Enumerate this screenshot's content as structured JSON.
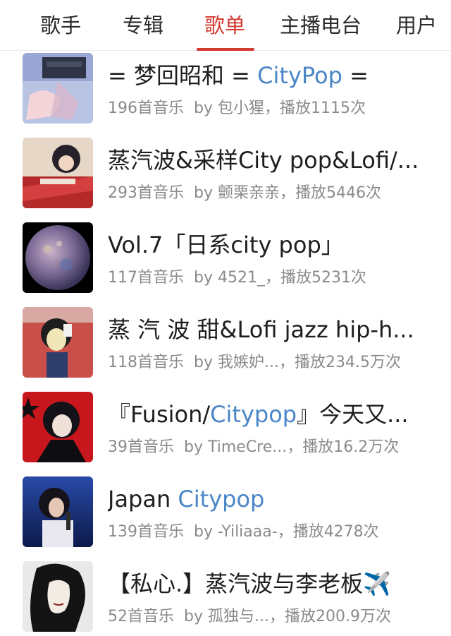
{
  "tabs": [
    {
      "label": "歌手",
      "active": false
    },
    {
      "label": "专辑",
      "active": false
    },
    {
      "label": "歌单",
      "active": true
    },
    {
      "label": "主播电台",
      "active": false
    },
    {
      "label": "用户",
      "active": false
    }
  ],
  "colors": {
    "accent": "#d33a31",
    "highlight": "#4a86c7",
    "meta": "#8a8a8a"
  },
  "playlists": [
    {
      "title_pre": "= 梦回昭和 = ",
      "title_hl": "CityPop",
      "title_post": " =",
      "count": "196首音乐",
      "by": "by 包小猩",
      "plays": "，播放1115次"
    },
    {
      "title_pre": "蒸汽波&采样City pop&Lofi/...",
      "title_hl": "",
      "title_post": "",
      "count": "293首音乐",
      "by": "by 颤栗亲亲",
      "plays": "，播放5446次"
    },
    {
      "title_pre": "Vol.7「日系city pop」",
      "title_hl": "",
      "title_post": "",
      "count": "117首音乐",
      "by": "by 4521_",
      "plays": "，播放5231次"
    },
    {
      "title_pre": "蒸 汽 波 甜&Lofi jazz hip-h...",
      "title_hl": "",
      "title_post": "",
      "count": "118首音乐",
      "by": "by 我嫉妒...",
      "plays": "，播放234.5万次"
    },
    {
      "title_pre": "『Fusion/",
      "title_hl": "Citypop",
      "title_post": "』今天又...",
      "count": "39首音乐",
      "by": "by TimeCre...",
      "plays": "，播放16.2万次"
    },
    {
      "title_pre": "Japan ",
      "title_hl": "Citypop",
      "title_post": "",
      "count": "139首音乐",
      "by": "by -Yiliaaa-",
      "plays": "，播放4278次"
    },
    {
      "title_pre": "【私心.】蒸汽波与李老板✈️",
      "title_hl": "",
      "title_post": "",
      "count": "52首音乐",
      "by": "by 孤独与...",
      "plays": "，播放200.9万次"
    }
  ]
}
